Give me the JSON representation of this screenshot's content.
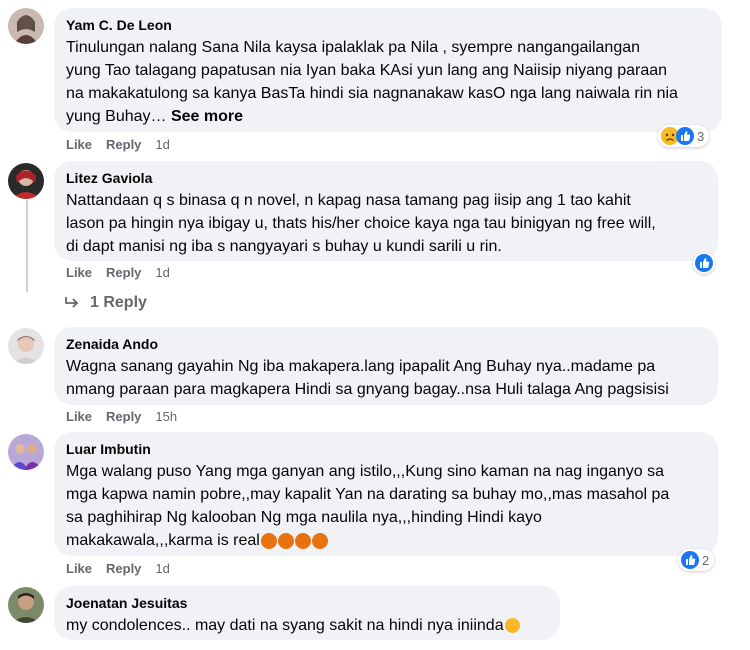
{
  "actions": {
    "like": "Like",
    "reply": "Reply"
  },
  "comments": [
    {
      "name": "Yam C. De Leon",
      "lines": [
        "Tinulungan nalang Sana Nila kaysa ipalaklak pa Nila , syempre nangangailangan",
        "yung Tao talagang papatusan nia Iyan baka KAsi yun lang ang Naiisip niyang paraan",
        "na makakatulong sa kanya BasTa hindi sia nagnanakaw kasO nga lang naiwala rin nia",
        "yung Buhay…"
      ],
      "see_more": "See more",
      "time": "1d",
      "reaction_count": "3"
    },
    {
      "name": "Litez Gaviola",
      "lines": [
        "Nattandaan q s binasa q n novel, n kapag nasa tamang pag iisip ang 1 tao kahit",
        "lason pa hingin nya ibigay u, thats his/her choice kaya nga tau binigyan ng free will,",
        "di dapt manisi ng iba s nangyayari s buhay u kundi sarili u rin."
      ],
      "time": "1d",
      "replies_label": "1 Reply"
    },
    {
      "name": "Zenaida Ando",
      "lines": [
        "Wagna sanang gayahin Ng iba makapera.lang ipapalit Ang Buhay nya..madame pa",
        "nmang paraan para magkapera Hindi sa gnyang bagay..nsa Huli talaga Ang pagsisisi"
      ],
      "time": "15h"
    },
    {
      "name": "Luar Imbutin",
      "lines": [
        "Mga walang puso Yang mga ganyan ang istilo,,,Kung sino kaman na nag inganyo sa",
        "mga kapwa namin pobre,,may kapalit Yan na darating sa buhay mo,,mas masahol pa",
        "sa paghihirap Ng kalooban Ng mga naulila nya,,,hinding Hindi kayo",
        "makakawala,,,karma is real"
      ],
      "time": "1d",
      "reaction_count": "2"
    },
    {
      "name": "Joenatan Jesuitas",
      "lines": [
        "my condolences.. may dati na syang sakit na hindi nya iniinda"
      ]
    }
  ],
  "colors": {
    "bubble": "#f0f2f5",
    "meta": "#65676b",
    "like_blue": "#1877f2",
    "sad_yellow": "#f7b928",
    "angry_orange": "#e9710f"
  }
}
